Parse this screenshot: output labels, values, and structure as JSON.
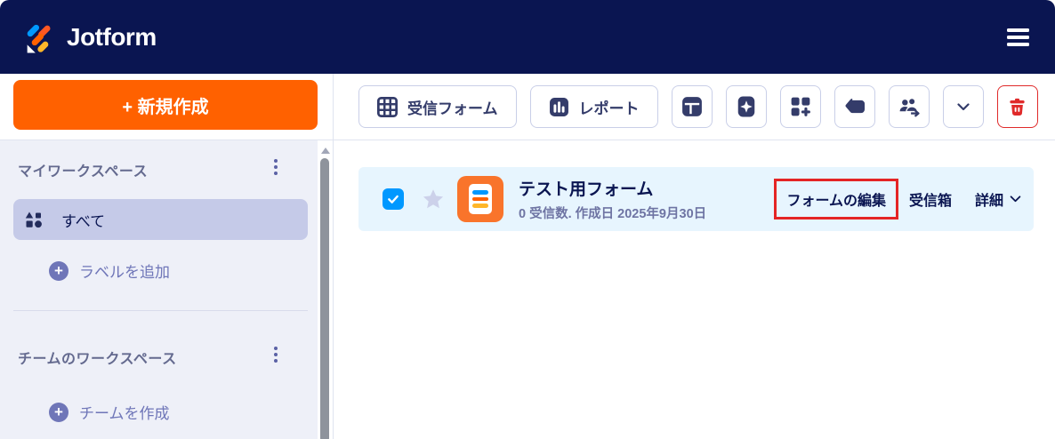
{
  "header": {
    "brand": "Jotform",
    "logo_icon": "jotform-logo-icon",
    "menu_icon": "hamburger-icon"
  },
  "sidebar": {
    "create_label": "+ 新規作成",
    "my_workspace": {
      "title": "マイワークスペース",
      "menu_icon": "kebab-icon"
    },
    "all_item": {
      "label": "すべて",
      "icon": "shapes-icon",
      "selected": true
    },
    "add_label": {
      "label": "ラベルを追加",
      "icon": "plus-circle-icon",
      "plus": "+"
    },
    "team_workspace": {
      "title": "チームのワークスペース",
      "menu_icon": "kebab-icon"
    },
    "create_team": {
      "label": "チームを作成",
      "icon": "plus-circle-icon",
      "plus": "+"
    }
  },
  "toolbar": {
    "submissions_label": "受信フォーム",
    "submissions_icon": "grid-table-icon",
    "reports_label": "レポート",
    "reports_icon": "bar-chart-icon",
    "icon_buttons": [
      "layout-icon",
      "sparkle-icon",
      "apps-plus-icon",
      "tag-icon",
      "move-team-icon",
      "chevron-down-icon",
      "trash-icon"
    ]
  },
  "form_row": {
    "checkbox_checked": true,
    "star_icon": "star-icon",
    "form_icon": "form-document-icon",
    "title": "テスト用フォーム",
    "meta": "0 受信数. 作成日 2025年9月30日",
    "edit_label": "フォームの編集",
    "inbox_label": "受信箱",
    "more_label": "詳細",
    "more_icon": "chevron-down-icon"
  },
  "annotation": {
    "type": "highlight-box",
    "color": "#e42525",
    "target": "フォームの編集"
  },
  "colors": {
    "brand_navy": "#0a1551",
    "brand_orange": "#ff6100",
    "accent_blue": "#0098ff",
    "danger_red": "#e02a2a",
    "row_bg": "#e7f5fe",
    "sidebar_bg": "#eef0f8",
    "selected_item_bg": "#c5cae8",
    "icon_navy": "#343c6a",
    "bar_blue": "#0098ff",
    "bar_orange": "#ff6100",
    "bar_yellow": "#ffb629"
  }
}
